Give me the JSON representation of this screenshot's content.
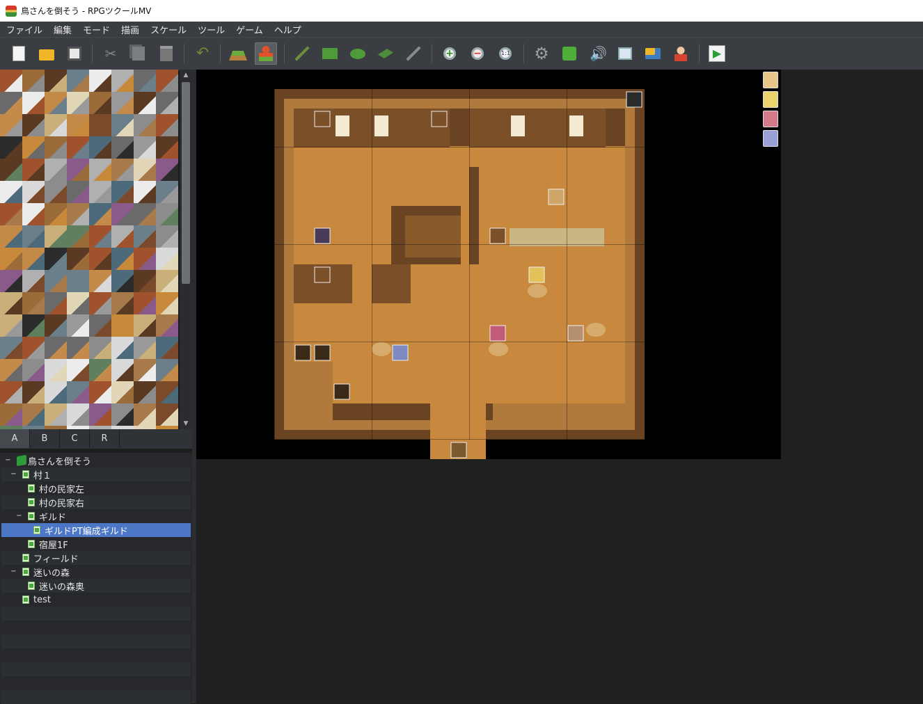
{
  "window": {
    "title": "鳥さんを倒そう - RPGツクールMV"
  },
  "menu": [
    "ファイル",
    "編集",
    "モード",
    "描画",
    "スケール",
    "ツール",
    "ゲーム",
    "ヘルプ"
  ],
  "toolbar_icons": [
    "new-project-icon",
    "open-project-icon",
    "save-project-icon",
    "cut-icon",
    "copy-icon",
    "paste-icon",
    "undo-icon",
    "map-mode-icon",
    "event-mode-icon",
    "pencil-icon",
    "rectangle-icon",
    "ellipse-icon",
    "fill-icon",
    "shadow-pen-icon",
    "zoom-in-icon",
    "zoom-out-icon",
    "zoom-actual-icon",
    "database-icon",
    "plugin-manager-icon",
    "sound-test-icon",
    "event-searcher-icon",
    "resource-manager-icon",
    "character-generator-icon",
    "playtest-icon"
  ],
  "tileset_tabs": [
    "A",
    "B",
    "C",
    "R"
  ],
  "tileset_active_tab": "A",
  "map_tree": [
    {
      "label": "鳥さんを倒そう",
      "type": "project",
      "toggle": "−"
    },
    {
      "label": "村１",
      "type": "map",
      "toggle": "−"
    },
    {
      "label": "村の民家左",
      "type": "map",
      "toggle": ""
    },
    {
      "label": "村の民家右",
      "type": "map",
      "toggle": ""
    },
    {
      "label": "ギルド",
      "type": "map",
      "toggle": "−"
    },
    {
      "label": "ギルドPT編成ギルド",
      "type": "map",
      "toggle": "",
      "selected": true
    },
    {
      "label": "宿屋1F",
      "type": "map",
      "toggle": ""
    },
    {
      "label": "フィールド",
      "type": "map",
      "toggle": ""
    },
    {
      "label": "迷いの森",
      "type": "map",
      "toggle": "−"
    },
    {
      "label": "迷いの森奥",
      "type": "map",
      "toggle": ""
    },
    {
      "label": "test",
      "type": "map",
      "toggle": ""
    }
  ],
  "colors": {
    "selection": "#4c76c6",
    "toolbar": "#3a3d41",
    "floor": "#c8893e",
    "wall": "#6a4322"
  }
}
